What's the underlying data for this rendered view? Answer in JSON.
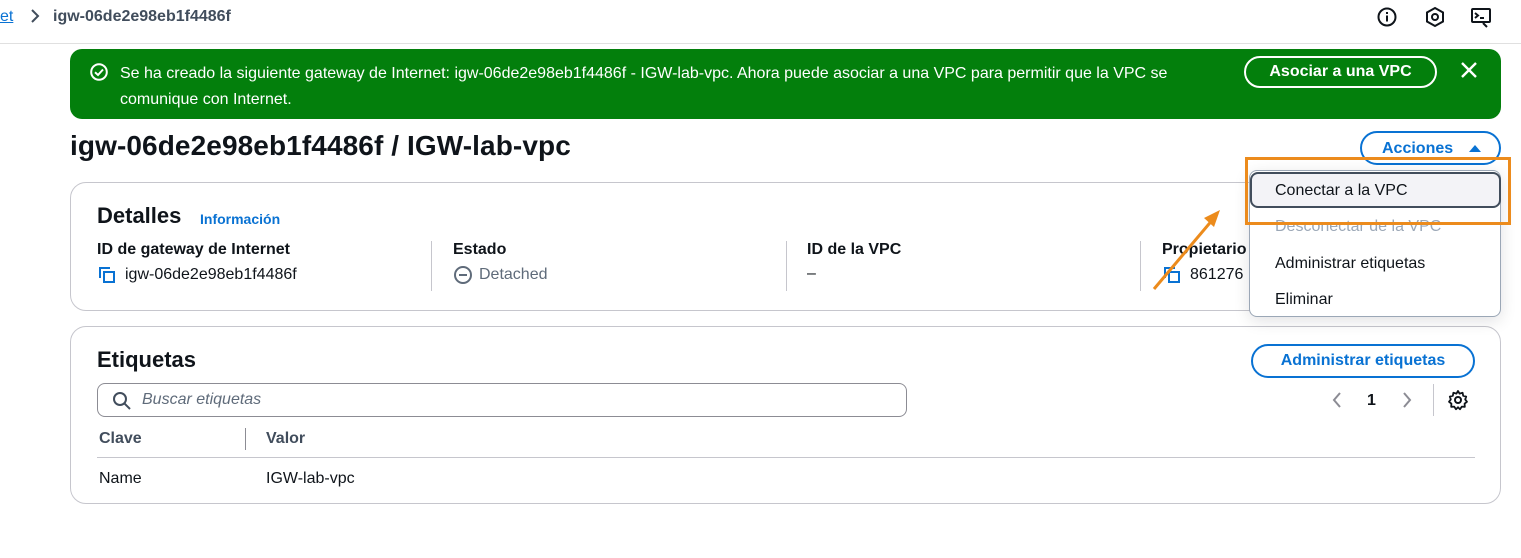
{
  "breadcrumb": {
    "parent_label": "et",
    "current_label": "igw-06de2e98eb1f4486f"
  },
  "top_icons": [
    "info-icon",
    "notifications-icon",
    "cloudshell-icon"
  ],
  "flash": {
    "message": "Se ha creado la siguiente gateway de Internet: igw-06de2e98eb1f4486f - IGW-lab-vpc. Ahora puede asociar a una VPC para permitir que la VPC se comunique con Internet.",
    "action_label": "Asociar a una VPC",
    "color": "#037f0c"
  },
  "page": {
    "title": "igw-06de2e98eb1f4486f / IGW-lab-vpc",
    "actions_label": "Acciones"
  },
  "dropdown": {
    "items": [
      {
        "label": "Conectar a la VPC",
        "disabled": false,
        "highlighted": true
      },
      {
        "label": "Desconectar de la VPC",
        "disabled": true
      },
      {
        "label": "Administrar etiquetas",
        "disabled": false
      },
      {
        "label": "Eliminar",
        "disabled": false
      }
    ]
  },
  "details": {
    "heading": "Detalles",
    "info_link": "Información",
    "columns": [
      {
        "label": "ID de gateway de Internet",
        "value": "igw-06de2e98eb1f4486f",
        "icon": "copy-icon"
      },
      {
        "label": "Estado",
        "value": "Detached",
        "icon": "status-stopped-icon"
      },
      {
        "label": "ID de la VPC",
        "value": "–"
      },
      {
        "label": "Propietario",
        "value": "861276",
        "icon": "copy-icon"
      }
    ]
  },
  "tags": {
    "heading": "Etiquetas",
    "manage_label": "Administrar etiquetas",
    "search_placeholder": "Buscar etiquetas",
    "page_number": "1",
    "columns": [
      "Clave",
      "Valor"
    ],
    "rows": [
      {
        "key": "Name",
        "value": "IGW-lab-vpc"
      }
    ]
  },
  "colors": {
    "accent": "#0972d3",
    "success": "#037f0c",
    "annotation": "#ec8b1c"
  }
}
